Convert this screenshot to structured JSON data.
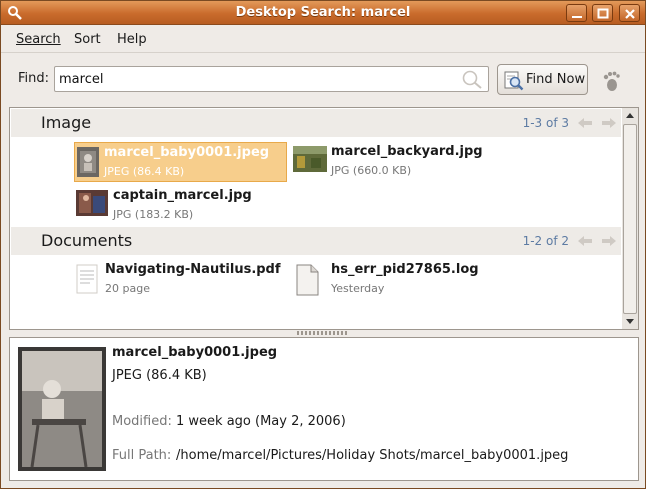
{
  "window": {
    "title": "Desktop Search: marcel"
  },
  "menu": [
    {
      "label": "Search"
    },
    {
      "label": "Sort"
    },
    {
      "label": "Help"
    }
  ],
  "find": {
    "label": "Find:",
    "value": "marcel",
    "button_label": "Find Now"
  },
  "categories": [
    {
      "title": "Image",
      "count": "1-3 of 3",
      "hits": [
        {
          "name": "marcel_baby0001.jpeg",
          "sub": "JPEG (86.4 KB)",
          "selected": true
        },
        {
          "name": "marcel_backyard.jpg",
          "sub": "JPG (660.0 KB)",
          "selected": false
        },
        {
          "name": "captain_marcel.jpg",
          "sub": "JPG (183.2 KB)",
          "selected": false
        }
      ]
    },
    {
      "title": "Documents",
      "count": "1-2 of 2",
      "hits": [
        {
          "name": "Navigating-Nautilus.pdf",
          "sub": "20 page",
          "selected": false
        },
        {
          "name": "hs_err_pid27865.log",
          "sub": "Yesterday",
          "selected": false
        }
      ]
    }
  ],
  "preview": {
    "name": "marcel_baby0001.jpeg",
    "type": "JPEG (86.4 KB)",
    "modified_label": "Modified:",
    "modified_value": "1 week ago (May 2, 2006)",
    "path_label": "Full Path:",
    "path_value": "/home/marcel/Pictures/Holiday Shots/marcel_baby0001.jpeg"
  },
  "colors": {
    "titlebar": "#c96b2c",
    "selection": "#f7ce8c",
    "count_link": "#5d7ba3"
  }
}
